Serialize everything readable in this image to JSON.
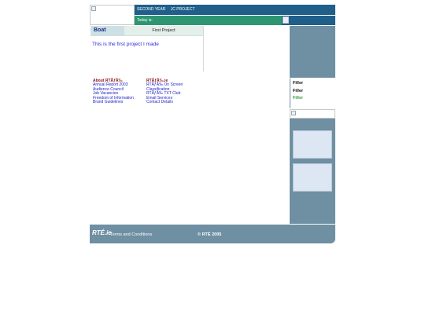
{
  "header": {
    "nav_items": [
      "SECOND YEAR",
      "JC PROJECT"
    ],
    "today_label": "Today is:"
  },
  "tab": {
    "left_label": "Boat",
    "right_label": "First Project"
  },
  "main": {
    "project_text": "This is the first project I made"
  },
  "links_left": {
    "heading": "About RTÃƒÂ‰",
    "items": [
      "Annual Report 2003",
      "Audience Council",
      "Job Vacancies",
      "Freedom of Information",
      "Brand Guidelines"
    ]
  },
  "links_right": {
    "heading": "RTÃƒÂ‰.ie",
    "items": [
      "RTÃƒÂ‰ On Screen",
      "Classification",
      "RTÃƒÂ‰ TXT Club",
      "Email Services",
      "Contact Details"
    ]
  },
  "sidebar": {
    "fillers": [
      {
        "label": "Filler",
        "color": "#111111"
      },
      {
        "label": "Filler",
        "color": "#111111"
      },
      {
        "label": "Filler",
        "color": "#3f9a3f"
      }
    ]
  },
  "footer": {
    "logo": "RTÉ.ie",
    "terms": "Terms and Conditions",
    "copyright": "© RTÉ 2005"
  },
  "colors": {
    "top_bar": "#1f5f8a",
    "green_bar": "#2d9572",
    "sidebar": "#6f8fa3",
    "footer": "#6f8fa3"
  }
}
